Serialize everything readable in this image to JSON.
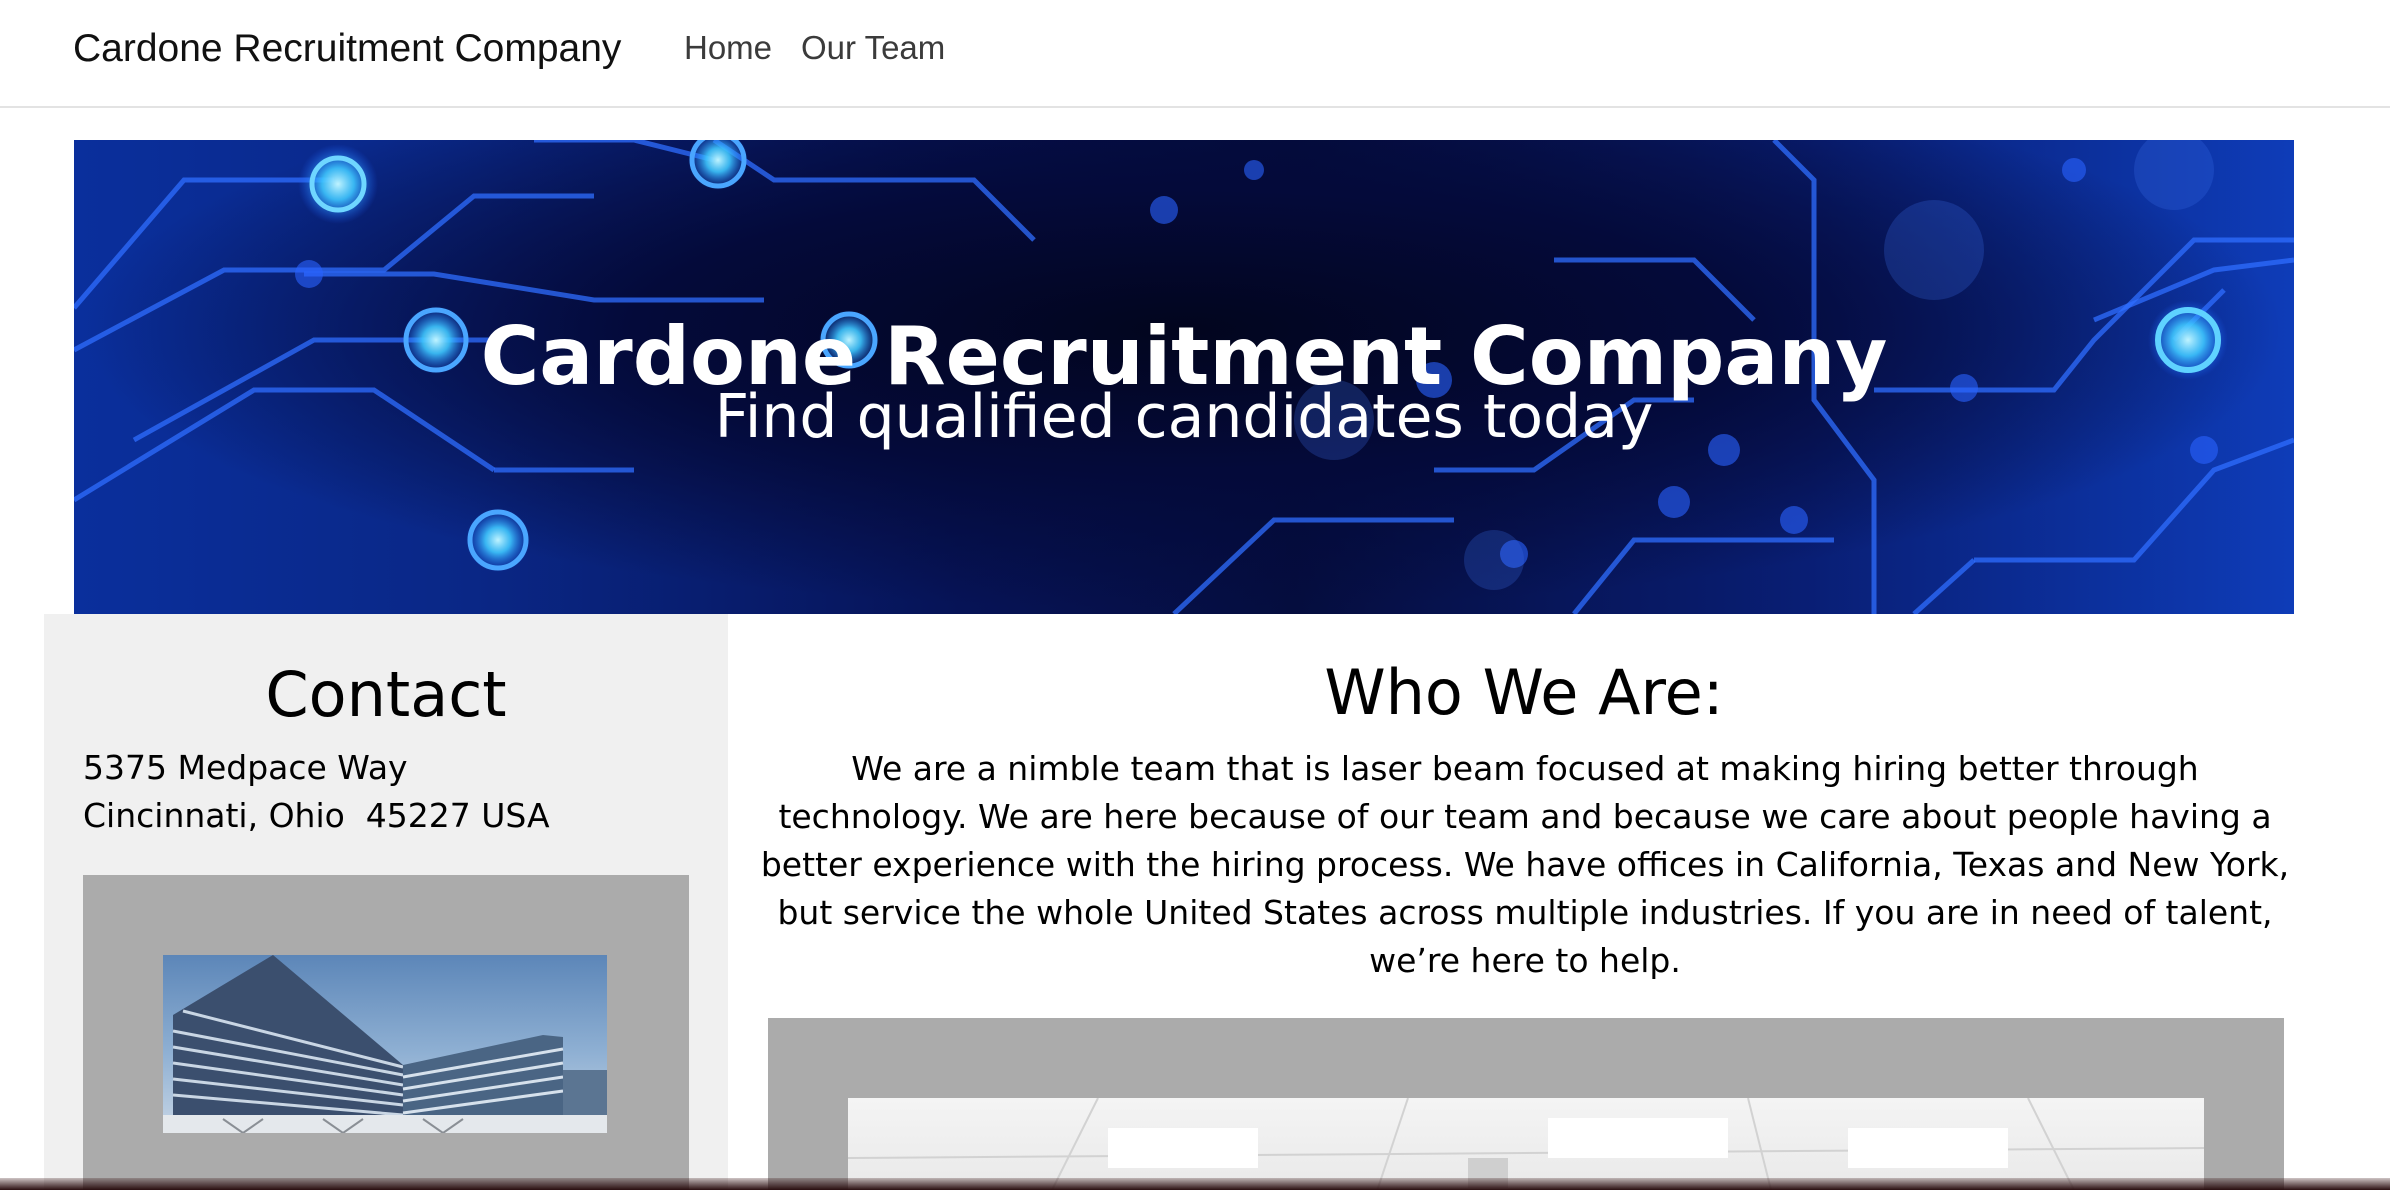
{
  "navbar": {
    "brand": "Cardone Recruitment Company",
    "links": [
      {
        "label": "Home"
      },
      {
        "label": "Our Team"
      }
    ]
  },
  "hero": {
    "title": "Cardone Recruitment Company",
    "subtitle": "Find qualified candidates today"
  },
  "contact": {
    "heading": "Contact",
    "address_line1": "5375 Medpace Way",
    "address_line2": "Cincinnati, Ohio  45227 USA"
  },
  "about": {
    "heading": "Who We Are:",
    "body": "We are a nimble team that is laser beam focused at making hiring better through technology. We are here because of our team and because we care about people having a better experience with the hiring process. We have offices in California, Texas and New York, but service the whole United States across multiple industries. If you are in need of talent, we’re here to help."
  },
  "colors": {
    "hero_dark": "#050d3e",
    "hero_blue": "#0e3cb8",
    "circuit_glow": "#3ec6ff",
    "contact_bg": "#f0f0f0",
    "photo_frame": "#ababab"
  }
}
